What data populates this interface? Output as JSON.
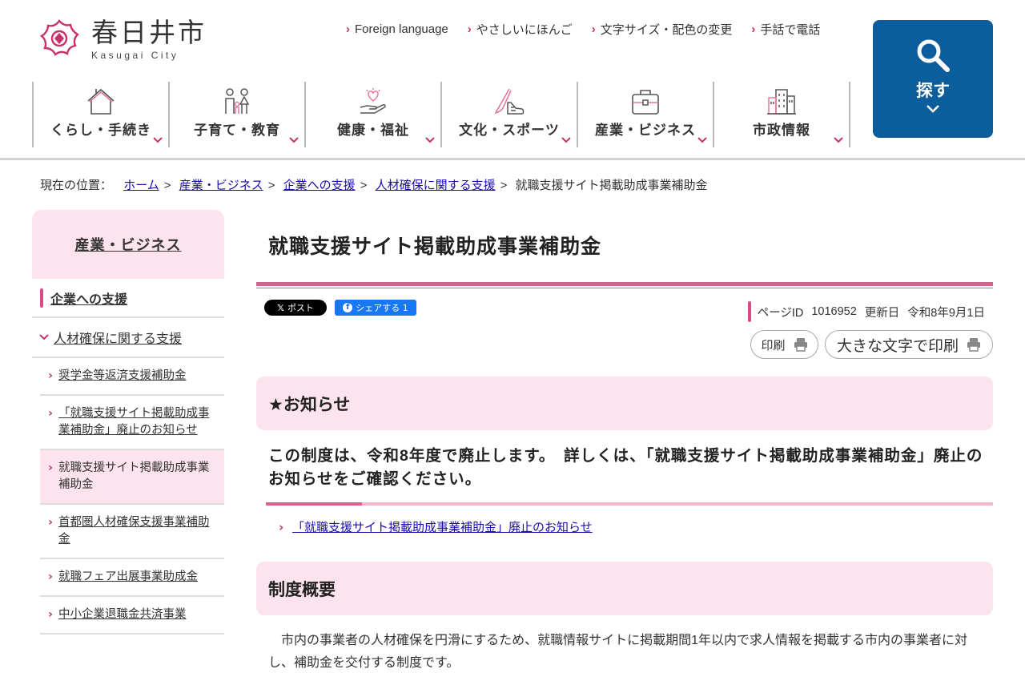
{
  "site": {
    "name_ja": "春日井市",
    "name_en": "Kasugai City",
    "brand_color": "#c8316a",
    "search_color": "#0b5e9b"
  },
  "utility_nav": [
    {
      "label": "Foreign language"
    },
    {
      "label": "やさしいにほんご"
    },
    {
      "label": "文字サイズ・配色の変更"
    },
    {
      "label": "手話で電話"
    }
  ],
  "search": {
    "label": "探す",
    "icon": "search-icon"
  },
  "global_nav": [
    {
      "label": "くらし・手続き",
      "icon": "house-icon"
    },
    {
      "label": "子育て・教育",
      "icon": "family-icon"
    },
    {
      "label": "健康・福祉",
      "icon": "heart-hand-icon"
    },
    {
      "label": "文化・スポーツ",
      "icon": "brush-shoe-icon"
    },
    {
      "label": "産業・ビジネス",
      "icon": "briefcase-icon"
    },
    {
      "label": "市政情報",
      "icon": "city-building-icon"
    }
  ],
  "breadcrumb": {
    "prefix": "現在の位置：",
    "items": [
      "ホーム",
      "産業・ビジネス",
      "企業への支援",
      "人材確保に関する支援"
    ],
    "current": "就職支援サイト掲載助成事業補助金"
  },
  "sidebar": {
    "heading": "産業・ビジネス",
    "category": "企業への支援",
    "subcategory": "人材確保に関する支援",
    "links": [
      {
        "label": "奨学金等返済支援補助金"
      },
      {
        "label": "「就職支援サイト掲載助成事業補助金」廃止のお知らせ"
      },
      {
        "label": "就職支援サイト掲載助成事業補助金"
      },
      {
        "label": "首都圏人材確保支援事業補助金"
      },
      {
        "label": "就職フェア出展事業助成金"
      },
      {
        "label": "中小企業退職金共済事業"
      }
    ]
  },
  "main": {
    "title": "就職支援サイト掲載助成事業補助金",
    "share": {
      "x_label": "ポスト",
      "fb_label": "シェアする 1"
    },
    "page_id_label": "ページID",
    "page_id": "1016952",
    "updated_label": "更新日",
    "updated": "令和8年9月1日",
    "print_label": "印刷",
    "print_large_label": "大きな文字で印刷",
    "section1_heading": "★お知らせ",
    "notice": "この制度は、令和8年度で廃止します。　詳しくは、「就職支援サイト掲載助成事業補助金」廃止のお知らせをご確認ください。",
    "notice_link": "「就職支援サイト掲載助成事業補助金」廃止のお知らせ",
    "section2_heading": "制度概要",
    "description": "市内の事業者の人材確保を円滑にするため、就職情報サイトに掲載期間1年以内で求人情報を掲載する市内の事業者に対し、補助金を交付する制度です。"
  }
}
